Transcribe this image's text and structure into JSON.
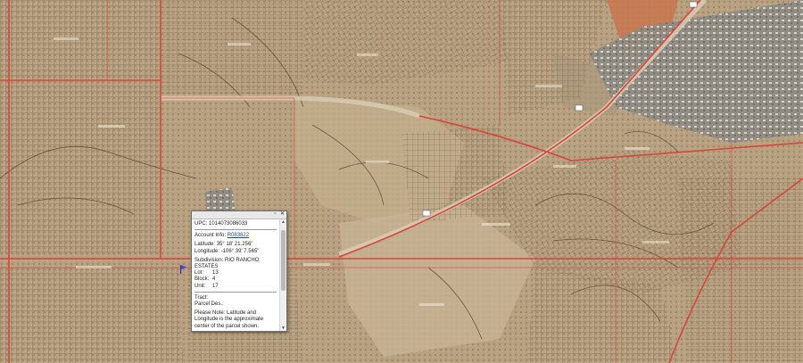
{
  "popup": {
    "upc_label": "UPC:",
    "upc_value": "1014073086033",
    "account_label": "Account Info:",
    "account_value": "R083822",
    "latitude_label": "Latitude:",
    "latitude_value": "35° 18' 21.256\"",
    "longitude_label": "Longitude:",
    "longitude_value": "-106° 39' 7.565\"",
    "subdivision_label": "Subdivision:",
    "subdivision_value": "RIO RANCHO ESTATES",
    "lot_label": "Lot:",
    "lot_value": "13",
    "block_label": "Block:",
    "block_value": "4",
    "unit_label": "Unit:",
    "unit_value": "17",
    "tract_label": "Tract:",
    "parcel_label": "Parcel Des.:",
    "note": "Please Note: Latitude and Longitude is the approximate center of the parcel shown."
  },
  "icons": {
    "close": "close-icon",
    "minimize": "minimize-icon",
    "marker": "flag-marker-icon"
  },
  "colors": {
    "road_red": "#d9453b",
    "parcel_line": "#5a4a38",
    "terrain": "#b7a07f"
  }
}
